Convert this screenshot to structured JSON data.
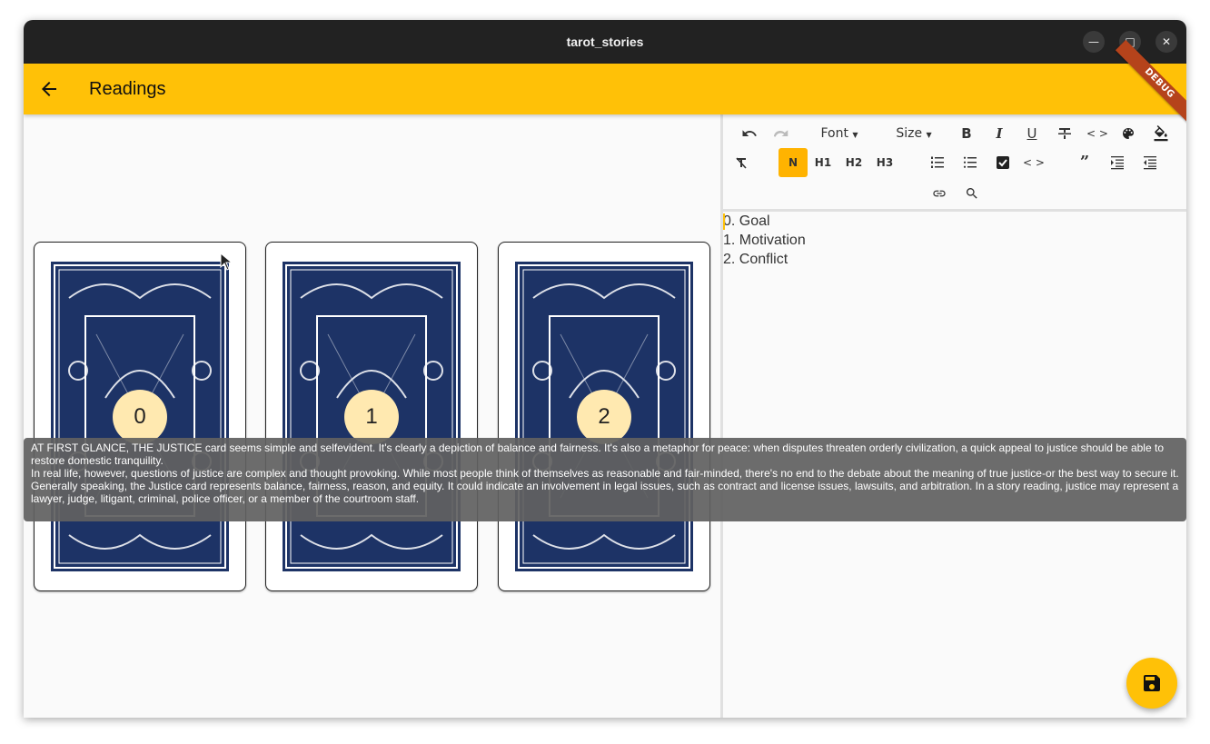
{
  "window": {
    "title": "tarot_stories",
    "controls": [
      "minimize",
      "maximize",
      "close"
    ]
  },
  "appbar": {
    "title": "Readings",
    "back_icon": "arrow-back-icon",
    "debug_banner": "DEBUG",
    "color": "#ffc107"
  },
  "cards": [
    {
      "index": "0",
      "position_label": "Goal"
    },
    {
      "index": "1",
      "position_label": "Motivation"
    },
    {
      "index": "2",
      "position_label": "Conflict"
    }
  ],
  "tooltip": {
    "paragraphs": [
      "AT FIRST GLANCE, THE JUSTICE card seems simple and selfevident. It's clearly a depiction of balance and fairness. It's also a metaphor for peace: when disputes threaten orderly civilization, a quick appeal to justice should be able to restore domestic tranquility.",
      "In real life, however, questions of justice are complex and thought provoking. While most people think of themselves as reasonable and fair-minded, there's no end to the debate about the meaning of true justice-or the best way to secure it.",
      "Generally speaking, the Justice card represents balance, fairness, reason, and equity. It could indicate an involvement in legal issues, such as contract and license issues, lawsuits, and arbitration. In a story reading, justice may represent a lawyer, judge, litigant, criminal, police officer, or a member of the courtroom staff."
    ]
  },
  "toolbar": {
    "font_label": "Font",
    "size_label": "Size",
    "normal_label": "N",
    "h1_label": "H1",
    "h2_label": "H2",
    "h3_label": "H3",
    "active_style": "N",
    "accent": "#ffb300"
  },
  "editor": {
    "lines": [
      "0. Goal",
      "1. Motivation",
      "2. Conflict"
    ]
  },
  "fab": {
    "icon": "save-icon"
  }
}
